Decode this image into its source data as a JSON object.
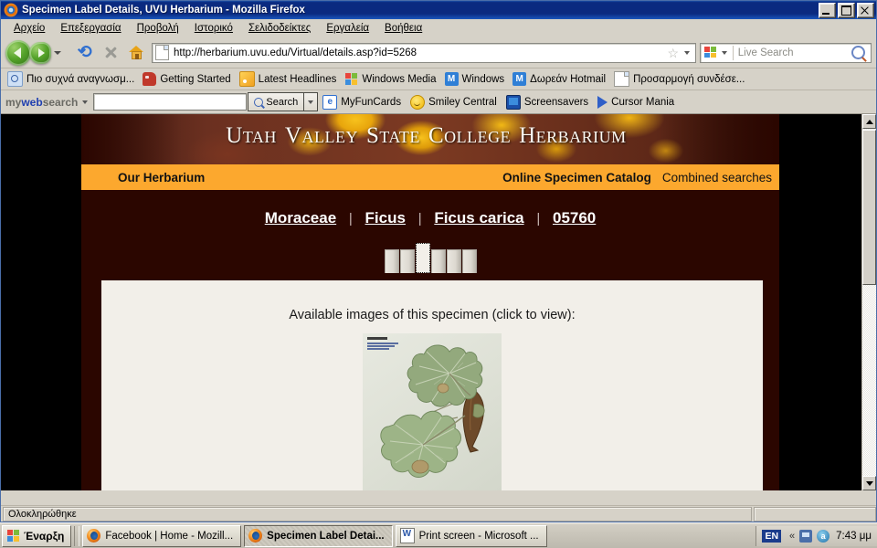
{
  "window": {
    "title": "Specimen Label Details, UVU Herbarium - Mozilla Firefox",
    "app_icon": "firefox-icon",
    "buttons": {
      "minimize": "minimize-button",
      "maximize": "maximize-button",
      "close": "close-button"
    }
  },
  "menu": [
    {
      "label": "Αρχείο"
    },
    {
      "label": "Επεξεργασία"
    },
    {
      "label": "Προβολή"
    },
    {
      "label": "Ιστορικό"
    },
    {
      "label": "Σελιδοδείκτες"
    },
    {
      "label": "Εργαλεία"
    },
    {
      "label": "Βοήθεια"
    }
  ],
  "toolbar": {
    "back": "back-button",
    "forward": "forward-button",
    "reload": "reload-button",
    "stop": "stop-button",
    "home": "home-button",
    "url": "http://herbarium.uvu.edu/Virtual/details.asp?id=5268",
    "bookmark_star": "☆",
    "search_placeholder": "Live Search",
    "search_value": ""
  },
  "bookmarks": [
    {
      "label": "Πιο συχνά αναγνωσμ...",
      "icon": "most-visited-icon"
    },
    {
      "label": "Getting Started",
      "icon": "getting-started-icon"
    },
    {
      "label": "Latest Headlines",
      "icon": "rss-icon"
    },
    {
      "label": "Windows Media",
      "icon": "windows-icon"
    },
    {
      "label": "Windows",
      "icon": "msn-icon"
    },
    {
      "label": "Δωρεάν Hotmail",
      "icon": "msn-icon"
    },
    {
      "label": "Προσαρμογή συνδέσε...",
      "icon": "document-icon"
    }
  ],
  "mywebsearch": {
    "brand_pre": "my",
    "brand_mid": "web",
    "brand_post": "search",
    "input_value": "",
    "search_label": "Search",
    "links": [
      {
        "label": "MyFunCards",
        "icon": "e-icon"
      },
      {
        "label": "Smiley Central",
        "icon": "smiley-icon"
      },
      {
        "label": "Screensavers",
        "icon": "monitor-icon"
      },
      {
        "label": "Cursor Mania",
        "icon": "cursor-icon"
      }
    ]
  },
  "page": {
    "banner_title": {
      "words": [
        {
          "cap": "U",
          "rest": "TAH"
        },
        {
          "cap": "V",
          "rest": "ALLEY"
        },
        {
          "cap": "S",
          "rest": "TATE"
        },
        {
          "cap": "C",
          "rest": "OLLEGE"
        },
        {
          "cap": "H",
          "rest": "ERBARIUM"
        }
      ]
    },
    "nav": {
      "left": "Our Herbarium",
      "center": "Online Specimen Catalog",
      "right": "Combined searches"
    },
    "breadcrumbs": [
      {
        "label": "Moraceae"
      },
      {
        "label": "Ficus"
      },
      {
        "label": "Ficus carica"
      },
      {
        "label": "05760"
      }
    ],
    "breadcrumb_separator": "|",
    "tabs": {
      "count": 6,
      "selected_index": 2
    },
    "caption": "Available images of this specimen (click to view):",
    "thumbnail": {
      "alt": "Ficus carica herbarium specimen sheet"
    }
  },
  "statusbar": {
    "text": "Ολοκληρώθηκε"
  },
  "taskbar": {
    "start_label": "Έναρξη",
    "items": [
      {
        "label": "Facebook | Home - Mozill...",
        "icon": "firefox-icon",
        "active": false
      },
      {
        "label": "Specimen Label Detai...",
        "icon": "firefox-icon",
        "active": true
      },
      {
        "label": "Print screen - Microsoft ...",
        "icon": "word-icon",
        "active": false
      }
    ],
    "tray": {
      "language": "EN",
      "chevron": "«",
      "clock": "7:43 μμ"
    }
  },
  "colors": {
    "accent_orange": "#fca82e",
    "page_dark": "#2b0600",
    "content_cream": "#f2efe9",
    "titlebar_blue": "#0a2a80"
  }
}
